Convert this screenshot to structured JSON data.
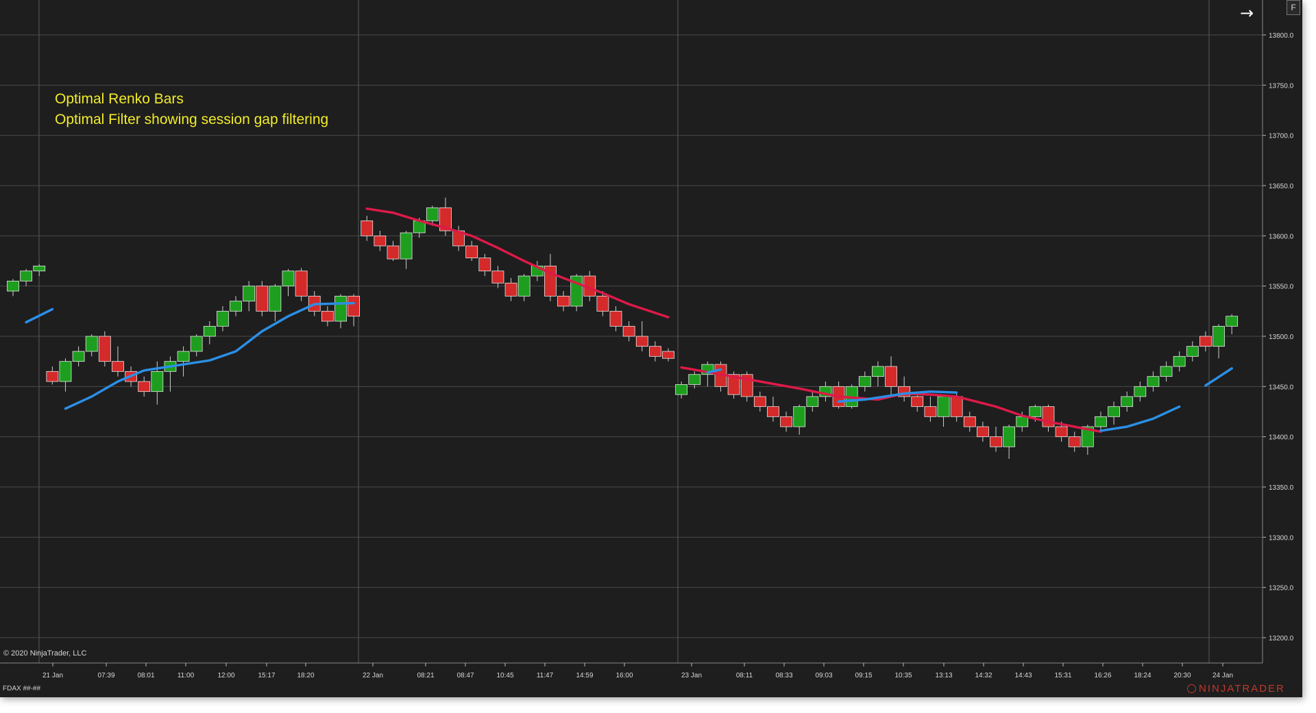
{
  "annotations": {
    "line1": "Optimal Renko Bars",
    "line2": "Optimal Filter showing session gap filtering"
  },
  "copyright": "© 2020 NinjaTrader, LLC",
  "instrument": "FDAX ##-##",
  "brand": "NINJATRADER",
  "buttons": {
    "arrow_icon": "arrow-right-icon",
    "f_label": "F"
  },
  "colors": {
    "background": "#1e1e1e",
    "grid": "#4a4a4a",
    "up_candle": "#1e9e1e",
    "down_candle": "#d42a2a",
    "filter_up": "#2b8fe6",
    "filter_down": "#dc1a48",
    "annotation_text": "#f2ec2a"
  },
  "chart_data": {
    "type": "candlestick",
    "title": "",
    "ylim": [
      13180,
      13833
    ],
    "yticks": [
      "13800.0",
      "13750.0",
      "13700.0",
      "13650.0",
      "13600.0",
      "13550.0",
      "13500.0",
      "13450.0",
      "13400.0",
      "13350.0",
      "13300.0",
      "13250.0",
      "13200.0"
    ],
    "xlabels": [
      "21 Jan",
      "07:39",
      "08:01",
      "11:00",
      "12:00",
      "15:17",
      "18:20",
      "22 Jan",
      "08:21",
      "08:47",
      "10:45",
      "11:47",
      "14:59",
      "16:00",
      "23 Jan",
      "08:11",
      "08:33",
      "09:03",
      "09:15",
      "10:35",
      "13:13",
      "14:32",
      "14:43",
      "15:31",
      "16:26",
      "18:24",
      "20:30",
      "24 Jan"
    ],
    "session_separators": [
      "21 Jan",
      "22 Jan",
      "23 Jan",
      "24 Jan"
    ],
    "bars": [
      {
        "dir": "up",
        "open": 13545,
        "close": 13555,
        "high": 13557,
        "low": 13540
      },
      {
        "dir": "up",
        "open": 13555,
        "close": 13565,
        "high": 13567,
        "low": 13550
      },
      {
        "dir": "up",
        "open": 13565,
        "close": 13570,
        "high": 13572,
        "low": 13560
      },
      {
        "dir": "down",
        "open": 13465,
        "close": 13455,
        "high": 13470,
        "low": 13452
      },
      {
        "dir": "up",
        "open": 13455,
        "close": 13475,
        "high": 13478,
        "low": 13445
      },
      {
        "dir": "up",
        "open": 13475,
        "close": 13485,
        "high": 13490,
        "low": 13470
      },
      {
        "dir": "up",
        "open": 13485,
        "close": 13500,
        "high": 13502,
        "low": 13480
      },
      {
        "dir": "down",
        "open": 13500,
        "close": 13475,
        "high": 13505,
        "low": 13470
      },
      {
        "dir": "down",
        "open": 13475,
        "close": 13465,
        "high": 13490,
        "low": 13460
      },
      {
        "dir": "down",
        "open": 13465,
        "close": 13455,
        "high": 13470,
        "low": 13450
      },
      {
        "dir": "down",
        "open": 13455,
        "close": 13445,
        "high": 13460,
        "low": 13440
      },
      {
        "dir": "up",
        "open": 13445,
        "close": 13465,
        "high": 13475,
        "low": 13432
      },
      {
        "dir": "up",
        "open": 13465,
        "close": 13475,
        "high": 13480,
        "low": 13445
      },
      {
        "dir": "up",
        "open": 13475,
        "close": 13485,
        "high": 13490,
        "low": 13460
      },
      {
        "dir": "up",
        "open": 13485,
        "close": 13500,
        "high": 13502,
        "low": 13480
      },
      {
        "dir": "up",
        "open": 13500,
        "close": 13510,
        "high": 13515,
        "low": 13492
      },
      {
        "dir": "up",
        "open": 13510,
        "close": 13525,
        "high": 13530,
        "low": 13505
      },
      {
        "dir": "up",
        "open": 13525,
        "close": 13535,
        "high": 13540,
        "low": 13520
      },
      {
        "dir": "up",
        "open": 13535,
        "close": 13550,
        "high": 13555,
        "low": 13525
      },
      {
        "dir": "down",
        "open": 13550,
        "close": 13525,
        "high": 13555,
        "low": 13520
      },
      {
        "dir": "up",
        "open": 13525,
        "close": 13550,
        "high": 13552,
        "low": 13515
      },
      {
        "dir": "up",
        "open": 13550,
        "close": 13565,
        "high": 13567,
        "low": 13540
      },
      {
        "dir": "down",
        "open": 13565,
        "close": 13540,
        "high": 13568,
        "low": 13535
      },
      {
        "dir": "down",
        "open": 13540,
        "close": 13525,
        "high": 13545,
        "low": 13520
      },
      {
        "dir": "down",
        "open": 13525,
        "close": 13515,
        "high": 13530,
        "low": 13510
      },
      {
        "dir": "up",
        "open": 13515,
        "close": 13540,
        "high": 13542,
        "low": 13508
      },
      {
        "dir": "down",
        "open": 13540,
        "close": 13520,
        "high": 13542,
        "low": 13510
      },
      {
        "dir": "down",
        "open": 13615,
        "close": 13600,
        "high": 13620,
        "low": 13595
      },
      {
        "dir": "down",
        "open": 13600,
        "close": 13590,
        "high": 13605,
        "low": 13585
      },
      {
        "dir": "down",
        "open": 13590,
        "close": 13577,
        "high": 13595,
        "low": 13575
      },
      {
        "dir": "up",
        "open": 13577,
        "close": 13603,
        "high": 13605,
        "low": 13567
      },
      {
        "dir": "up",
        "open": 13603,
        "close": 13615,
        "high": 13618,
        "low": 13598
      },
      {
        "dir": "up",
        "open": 13615,
        "close": 13628,
        "high": 13630,
        "low": 13610
      },
      {
        "dir": "down",
        "open": 13628,
        "close": 13605,
        "high": 13638,
        "low": 13600
      },
      {
        "dir": "down",
        "open": 13605,
        "close": 13590,
        "high": 13610,
        "low": 13585
      },
      {
        "dir": "down",
        "open": 13590,
        "close": 13578,
        "high": 13595,
        "low": 13575
      },
      {
        "dir": "down",
        "open": 13578,
        "close": 13565,
        "high": 13582,
        "low": 13560
      },
      {
        "dir": "down",
        "open": 13565,
        "close": 13553,
        "high": 13570,
        "low": 13548
      },
      {
        "dir": "down",
        "open": 13553,
        "close": 13540,
        "high": 13558,
        "low": 13535
      },
      {
        "dir": "up",
        "open": 13540,
        "close": 13560,
        "high": 13562,
        "low": 13535
      },
      {
        "dir": "up",
        "open": 13560,
        "close": 13570,
        "high": 13575,
        "low": 13555
      },
      {
        "dir": "down",
        "open": 13570,
        "close": 13540,
        "high": 13582,
        "low": 13535
      },
      {
        "dir": "down",
        "open": 13540,
        "close": 13530,
        "high": 13545,
        "low": 13525
      },
      {
        "dir": "up",
        "open": 13530,
        "close": 13560,
        "high": 13562,
        "low": 13525
      },
      {
        "dir": "down",
        "open": 13560,
        "close": 13540,
        "high": 13565,
        "low": 13535
      },
      {
        "dir": "down",
        "open": 13540,
        "close": 13525,
        "high": 13545,
        "low": 13520
      },
      {
        "dir": "down",
        "open": 13525,
        "close": 13510,
        "high": 13530,
        "low": 13505
      },
      {
        "dir": "down",
        "open": 13510,
        "close": 13500,
        "high": 13515,
        "low": 13495
      },
      {
        "dir": "down",
        "open": 13500,
        "close": 13490,
        "high": 13515,
        "low": 13485
      },
      {
        "dir": "down",
        "open": 13490,
        "close": 13480,
        "high": 13495,
        "low": 13475
      },
      {
        "dir": "down",
        "open": 13485,
        "close": 13478,
        "high": 13488,
        "low": 13475
      },
      {
        "dir": "up",
        "open": 13442,
        "close": 13452,
        "high": 13455,
        "low": 13438
      },
      {
        "dir": "up",
        "open": 13452,
        "close": 13462,
        "high": 13465,
        "low": 13448
      },
      {
        "dir": "up",
        "open": 13462,
        "close": 13472,
        "high": 13475,
        "low": 13450
      },
      {
        "dir": "down",
        "open": 13472,
        "close": 13450,
        "high": 13475,
        "low": 13445
      },
      {
        "dir": "down",
        "open": 13462,
        "close": 13442,
        "high": 13465,
        "low": 13438
      },
      {
        "dir": "down",
        "open": 13462,
        "close": 13440,
        "high": 13465,
        "low": 13435
      },
      {
        "dir": "down",
        "open": 13440,
        "close": 13430,
        "high": 13445,
        "low": 13425
      },
      {
        "dir": "down",
        "open": 13430,
        "close": 13420,
        "high": 13440,
        "low": 13415
      },
      {
        "dir": "down",
        "open": 13420,
        "close": 13410,
        "high": 13425,
        "low": 13405
      },
      {
        "dir": "up",
        "open": 13410,
        "close": 13430,
        "high": 13432,
        "low": 13402
      },
      {
        "dir": "up",
        "open": 13430,
        "close": 13440,
        "high": 13445,
        "low": 13425
      },
      {
        "dir": "up",
        "open": 13440,
        "close": 13450,
        "high": 13455,
        "low": 13435
      },
      {
        "dir": "down",
        "open": 13450,
        "close": 13430,
        "high": 13455,
        "low": 13428
      },
      {
        "dir": "up",
        "open": 13430,
        "close": 13450,
        "high": 13452,
        "low": 13428
      },
      {
        "dir": "up",
        "open": 13450,
        "close": 13460,
        "high": 13465,
        "low": 13445
      },
      {
        "dir": "up",
        "open": 13460,
        "close": 13470,
        "high": 13475,
        "low": 13450
      },
      {
        "dir": "down",
        "open": 13470,
        "close": 13450,
        "high": 13480,
        "low": 13440
      },
      {
        "dir": "down",
        "open": 13450,
        "close": 13440,
        "high": 13460,
        "low": 13435
      },
      {
        "dir": "down",
        "open": 13440,
        "close": 13430,
        "high": 13445,
        "low": 13425
      },
      {
        "dir": "down",
        "open": 13430,
        "close": 13420,
        "high": 13440,
        "low": 13415
      },
      {
        "dir": "up",
        "open": 13420,
        "close": 13440,
        "high": 13442,
        "low": 13410
      },
      {
        "dir": "down",
        "open": 13440,
        "close": 13420,
        "high": 13445,
        "low": 13415
      },
      {
        "dir": "down",
        "open": 13420,
        "close": 13410,
        "high": 13425,
        "low": 13405
      },
      {
        "dir": "down",
        "open": 13410,
        "close": 13400,
        "high": 13415,
        "low": 13395
      },
      {
        "dir": "down",
        "open": 13400,
        "close": 13390,
        "high": 13410,
        "low": 13385
      },
      {
        "dir": "up",
        "open": 13390,
        "close": 13410,
        "high": 13412,
        "low": 13378
      },
      {
        "dir": "up",
        "open": 13410,
        "close": 13420,
        "high": 13425,
        "low": 13405
      },
      {
        "dir": "up",
        "open": 13420,
        "close": 13430,
        "high": 13432,
        "low": 13415
      },
      {
        "dir": "down",
        "open": 13430,
        "close": 13410,
        "high": 13432,
        "low": 13405
      },
      {
        "dir": "down",
        "open": 13410,
        "close": 13400,
        "high": 13415,
        "low": 13395
      },
      {
        "dir": "down",
        "open": 13400,
        "close": 13390,
        "high": 13405,
        "low": 13385
      },
      {
        "dir": "up",
        "open": 13390,
        "close": 13410,
        "high": 13412,
        "low": 13382
      },
      {
        "dir": "up",
        "open": 13410,
        "close": 13420,
        "high": 13425,
        "low": 13405
      },
      {
        "dir": "up",
        "open": 13420,
        "close": 13430,
        "high": 13435,
        "low": 13412
      },
      {
        "dir": "up",
        "open": 13430,
        "close": 13440,
        "high": 13445,
        "low": 13425
      },
      {
        "dir": "up",
        "open": 13440,
        "close": 13450,
        "high": 13455,
        "low": 13435
      },
      {
        "dir": "up",
        "open": 13450,
        "close": 13460,
        "high": 13465,
        "low": 13445
      },
      {
        "dir": "up",
        "open": 13460,
        "close": 13470,
        "high": 13475,
        "low": 13455
      },
      {
        "dir": "up",
        "open": 13470,
        "close": 13480,
        "high": 13485,
        "low": 13465
      },
      {
        "dir": "up",
        "open": 13480,
        "close": 13490,
        "high": 13495,
        "low": 13475
      },
      {
        "dir": "down",
        "open": 13500,
        "close": 13490,
        "high": 13505,
        "low": 13485
      },
      {
        "dir": "up",
        "open": 13490,
        "close": 13510,
        "high": 13512,
        "low": 13478
      },
      {
        "dir": "up",
        "open": 13510,
        "close": 13520,
        "high": 13522,
        "low": 13502
      }
    ],
    "optimal_filter": [
      {
        "color": "up",
        "points": [
          [
            1,
            13514
          ],
          [
            3,
            13527
          ]
        ]
      },
      {
        "color": "up",
        "points": [
          [
            4,
            13428
          ],
          [
            6,
            13440
          ],
          [
            8,
            13455
          ],
          [
            10,
            13466
          ],
          [
            12,
            13470
          ],
          [
            15,
            13476
          ],
          [
            17,
            13485
          ],
          [
            19,
            13505
          ],
          [
            21,
            13520
          ],
          [
            23,
            13532
          ],
          [
            26,
            13533
          ]
        ]
      },
      {
        "color": "down",
        "points": [
          [
            27,
            13627
          ],
          [
            29,
            13623
          ],
          [
            31,
            13615
          ],
          [
            33,
            13608
          ],
          [
            35,
            13600
          ],
          [
            37,
            13588
          ],
          [
            39,
            13575
          ],
          [
            41,
            13563
          ],
          [
            43,
            13553
          ],
          [
            45,
            13543
          ],
          [
            47,
            13532
          ],
          [
            50,
            13519
          ]
        ]
      },
      {
        "color": "down",
        "points": [
          [
            51,
            13469
          ],
          [
            54,
            13462
          ],
          [
            57,
            13455
          ],
          [
            60,
            13448
          ],
          [
            63,
            13440
          ],
          [
            66,
            13437
          ],
          [
            68,
            13443
          ],
          [
            70,
            13442
          ],
          [
            72,
            13440
          ],
          [
            75,
            13430
          ],
          [
            77,
            13421
          ],
          [
            79,
            13415
          ],
          [
            81,
            13410
          ],
          [
            83,
            13405
          ]
        ]
      },
      {
        "color": "up",
        "points": [
          [
            53,
            13464
          ],
          [
            54,
            13467
          ]
        ]
      },
      {
        "color": "up",
        "points": [
          [
            63,
            13435
          ],
          [
            65,
            13437
          ],
          [
            68,
            13443
          ],
          [
            70,
            13445
          ],
          [
            72,
            13444
          ]
        ]
      },
      {
        "color": "up",
        "points": [
          [
            83,
            13406
          ],
          [
            85,
            13410
          ],
          [
            87,
            13418
          ],
          [
            89,
            13430
          ]
        ]
      },
      {
        "color": "up",
        "points": [
          [
            91,
            13451
          ],
          [
            93,
            13468
          ]
        ]
      }
    ]
  }
}
